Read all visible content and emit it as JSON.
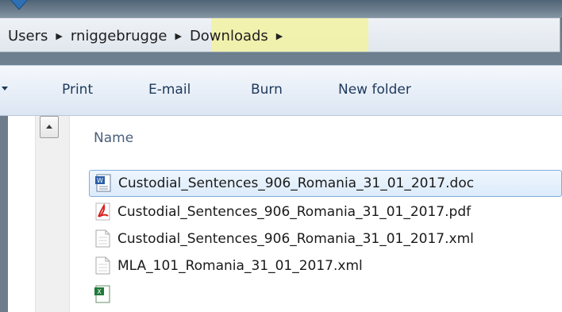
{
  "breadcrumbs": {
    "items": [
      "Users",
      "rniggebrugge",
      "Downloads"
    ]
  },
  "toolbar": {
    "buttons": [
      "Print",
      "E-mail",
      "Burn",
      "New folder"
    ]
  },
  "file_list": {
    "column_header": "Name",
    "files": [
      {
        "name": "Custodial_Sentences_906_Romania_31_01_2017.doc",
        "icon": "word-document-icon",
        "selected": true
      },
      {
        "name": "Custodial_Sentences_906_Romania_31_01_2017.pdf",
        "icon": "pdf-file-icon",
        "selected": false
      },
      {
        "name": "Custodial_Sentences_906_Romania_31_01_2017.xml",
        "icon": "xml-file-icon",
        "selected": false
      },
      {
        "name": "MLA_101_Romania_31_01_2017.xml",
        "icon": "xml-file-icon",
        "selected": false
      },
      {
        "name": "",
        "icon": "excel-file-icon",
        "selected": false
      }
    ]
  },
  "colors": {
    "highlight": "#f2f2a6",
    "selection_border": "#84acdd",
    "toolbar_text": "#1e395b"
  }
}
